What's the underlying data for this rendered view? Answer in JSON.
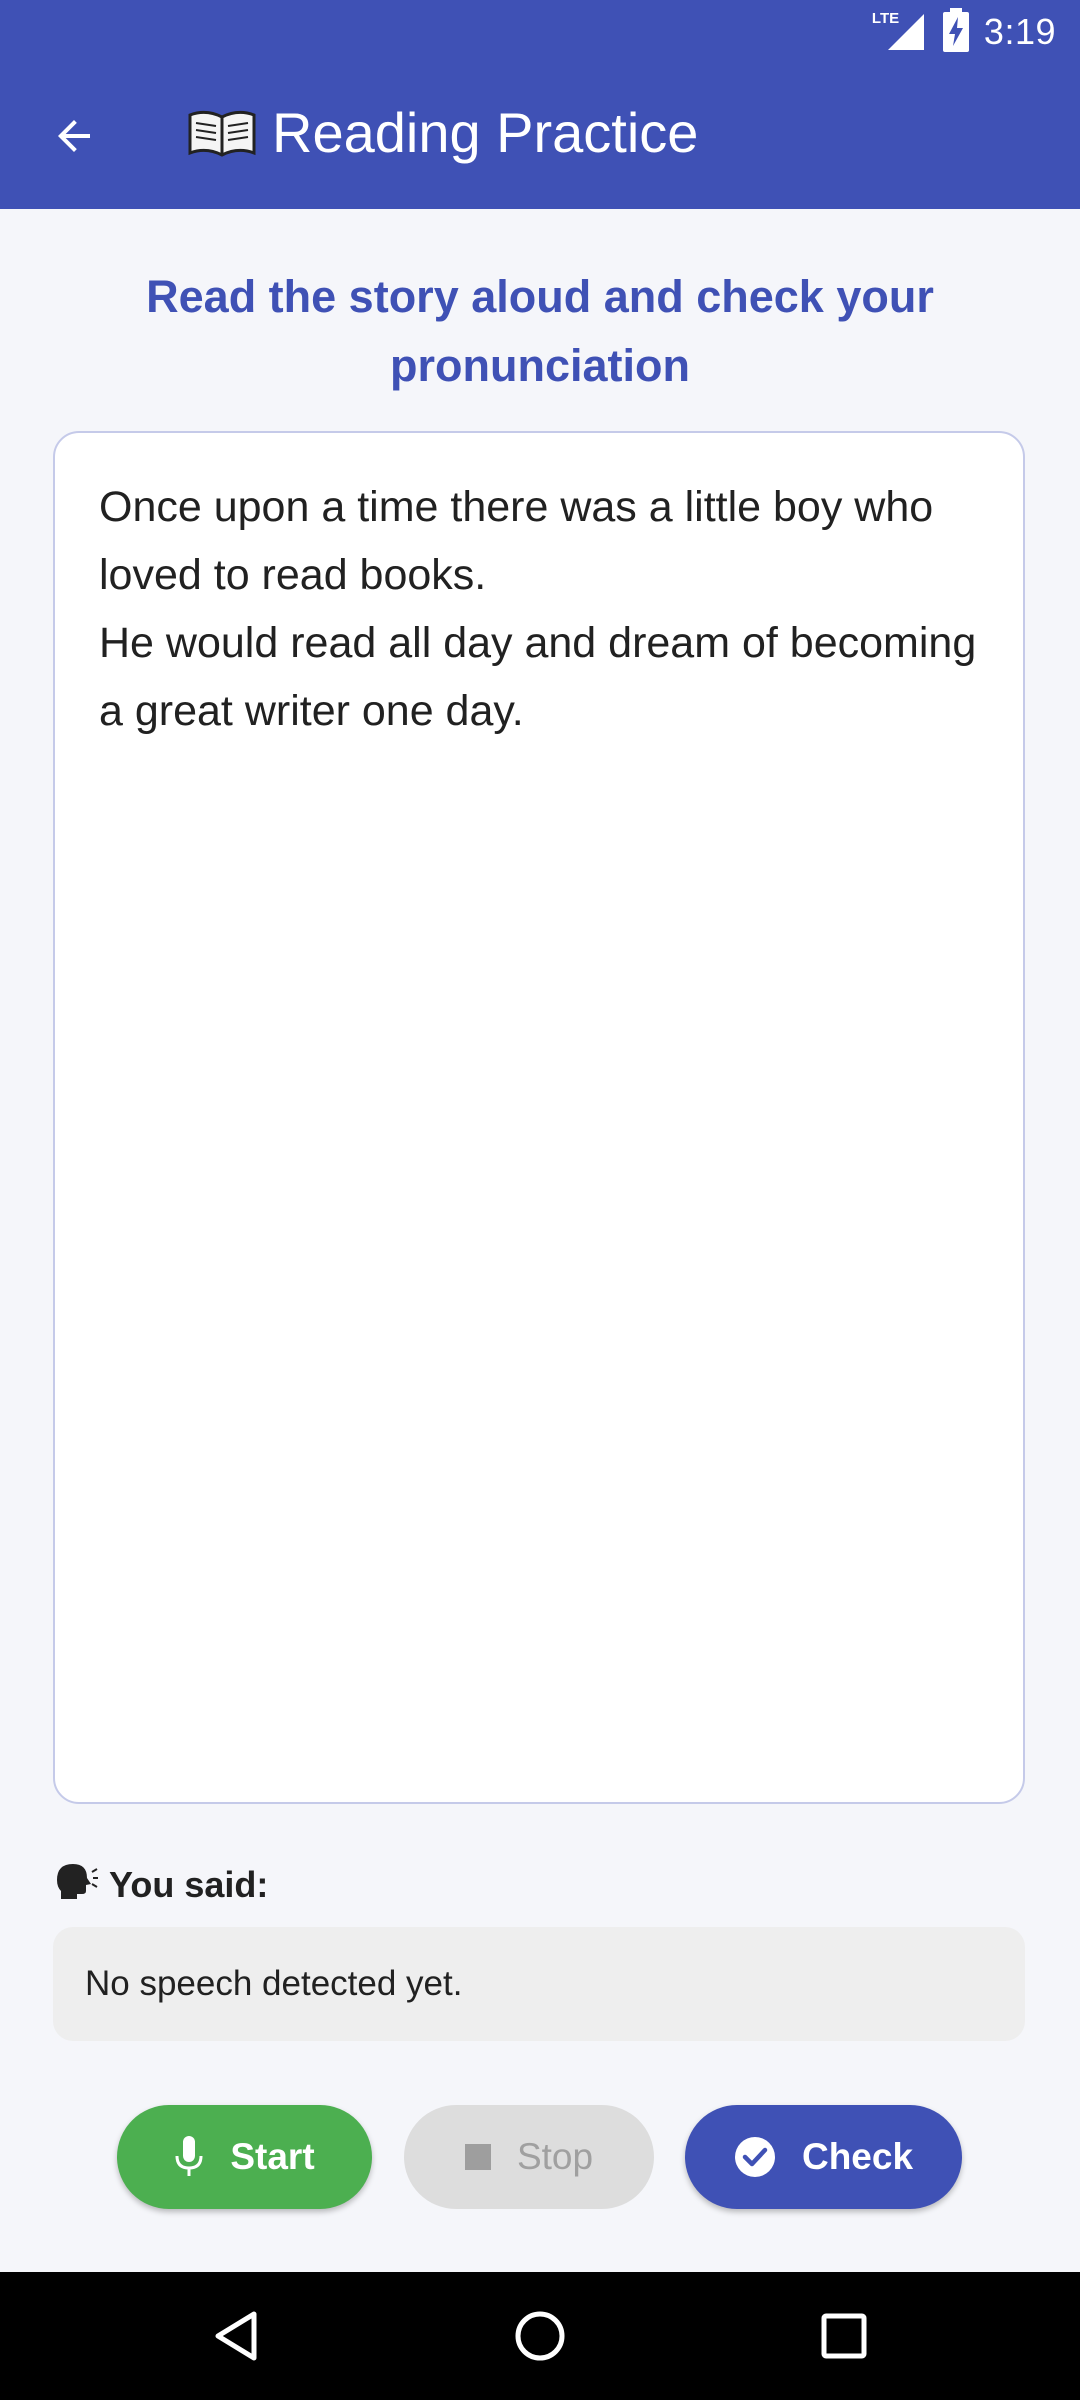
{
  "status_bar": {
    "time": "3:19",
    "network": "LTE",
    "icons": [
      "lte-signal-icon",
      "battery-charging-icon"
    ]
  },
  "app_bar": {
    "title": "Reading Practice",
    "back_icon": "arrow-back-icon",
    "title_icon": "open-book-icon"
  },
  "instruction": "Read the story aloud and check your pronunciation",
  "story": {
    "text": "Once upon a time there was a little boy who loved to read books.\nHe would read all day and dream of becoming a great writer one day."
  },
  "recognition": {
    "label": "You said:",
    "label_icon": "speaking-head-icon",
    "result": "No speech detected yet."
  },
  "actions": {
    "start_label": "Start",
    "stop_label": "Stop",
    "check_label": "Check",
    "start_enabled": true,
    "stop_enabled": false,
    "check_enabled": true
  },
  "nav_bar": {
    "icons": [
      "nav-back-icon",
      "nav-home-icon",
      "nav-recents-icon"
    ]
  },
  "colors": {
    "primary": "#3F51B5",
    "start": "#4CAF50",
    "disabled": "#DDDDDD",
    "background": "#F5F6FA"
  }
}
